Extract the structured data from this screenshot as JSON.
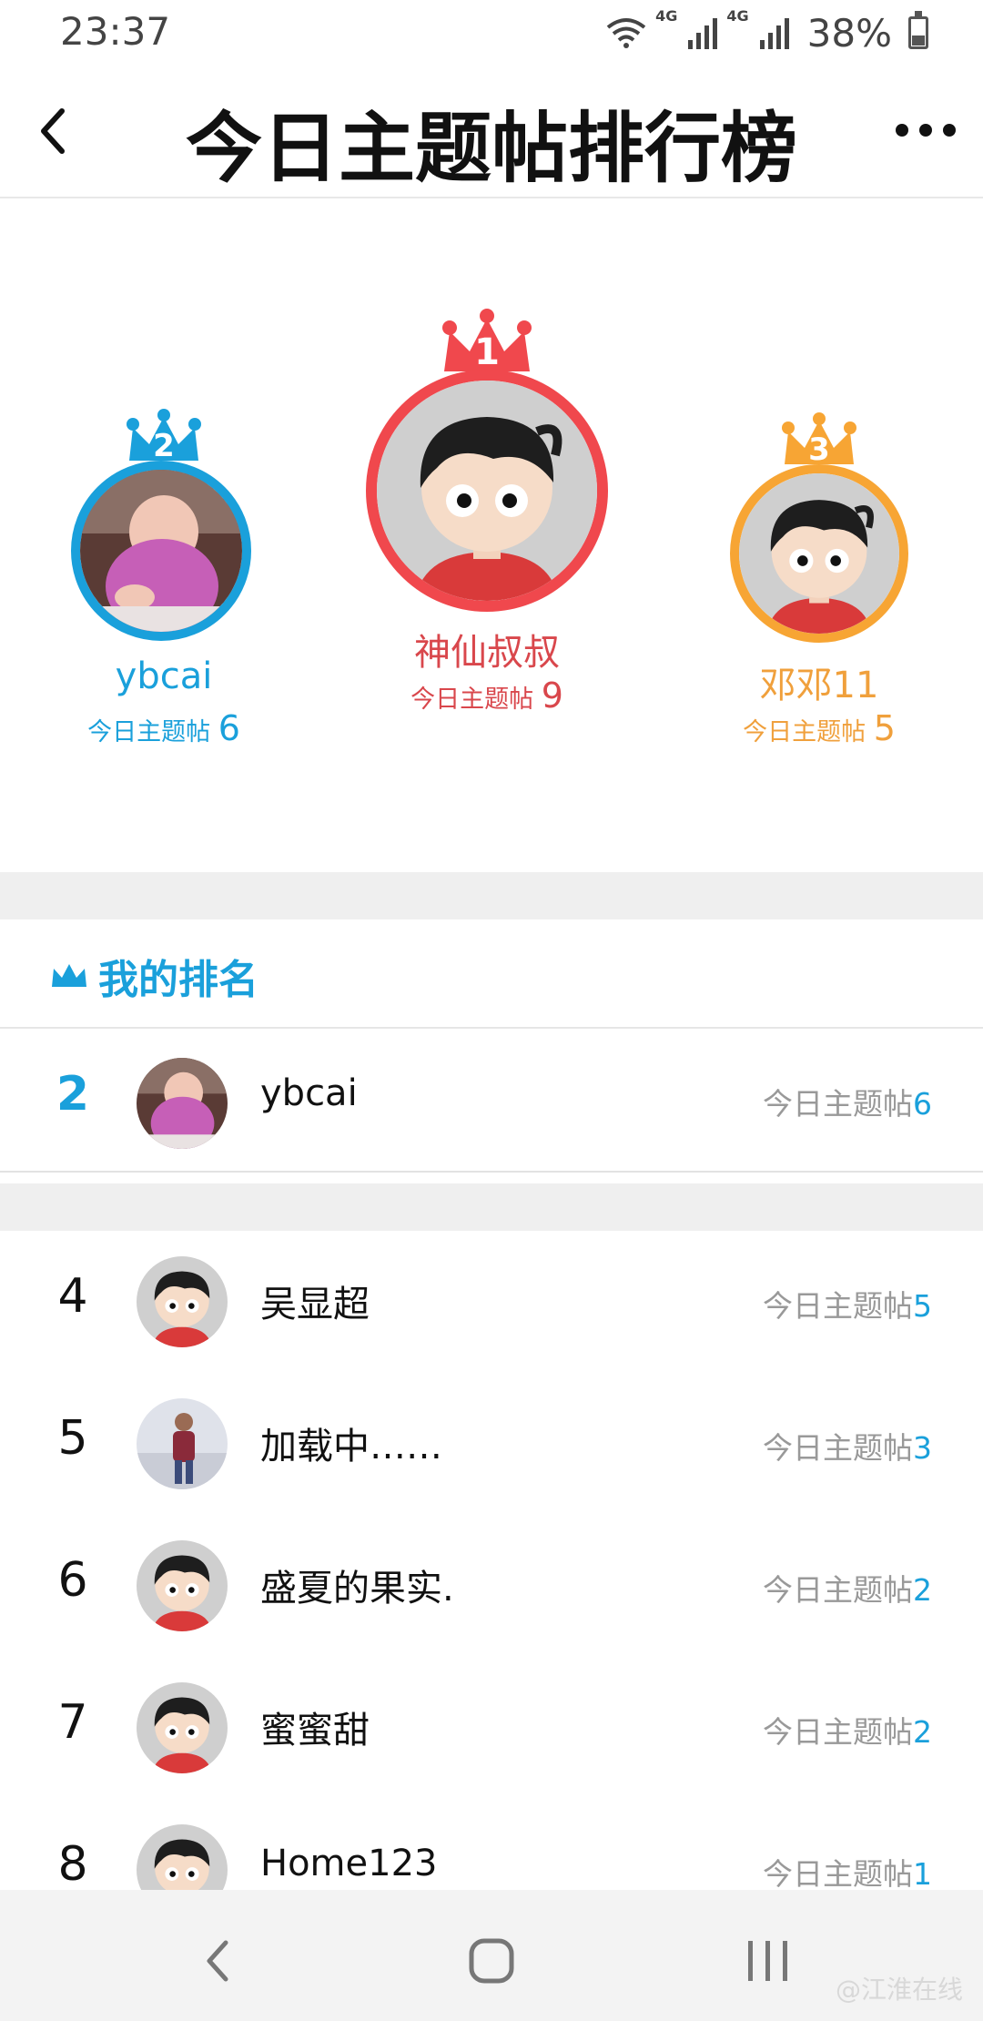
{
  "status_bar": {
    "time": "23:37",
    "network": "4G",
    "battery": "38%",
    "battery_level": 0.38
  },
  "header": {
    "title": "今日主题帖排行榜"
  },
  "podium": [
    {
      "rank": "2",
      "name": "ybcai",
      "count_label": "今日主题帖",
      "count": "6",
      "color": "#1aa0db"
    },
    {
      "rank": "1",
      "name": "神仙叔叔",
      "count_label": "今日主题帖",
      "count": "9",
      "color": "#f0484d"
    },
    {
      "rank": "3",
      "name": "邓邓11",
      "count_label": "今日主题帖",
      "count": "5",
      "color": "#f7a534"
    }
  ],
  "my_rank": {
    "title": "我的排名",
    "rank": "2",
    "name": "ybcai",
    "count_label": "今日主题帖",
    "count": "6"
  },
  "list": [
    {
      "rank": "4",
      "name": "吴显超",
      "count_label": "今日主题帖",
      "count": "5",
      "avatar": "cartoon"
    },
    {
      "rank": "5",
      "name": "加载中……",
      "count_label": "今日主题帖",
      "count": "3",
      "avatar": "photo-man"
    },
    {
      "rank": "6",
      "name": "盛夏的果实.",
      "count_label": "今日主题帖",
      "count": "2",
      "avatar": "cartoon"
    },
    {
      "rank": "7",
      "name": "蜜蜜甜",
      "count_label": "今日主题帖",
      "count": "2",
      "avatar": "cartoon"
    },
    {
      "rank": "8",
      "name": "Home123",
      "count_label": "今日主题帖",
      "count": "1",
      "avatar": "cartoon"
    }
  ],
  "watermark": "@江淮在线",
  "colors": {
    "accent": "#1aa0db",
    "first": "#f0484d",
    "second": "#1aa0db",
    "third": "#f7a534"
  }
}
